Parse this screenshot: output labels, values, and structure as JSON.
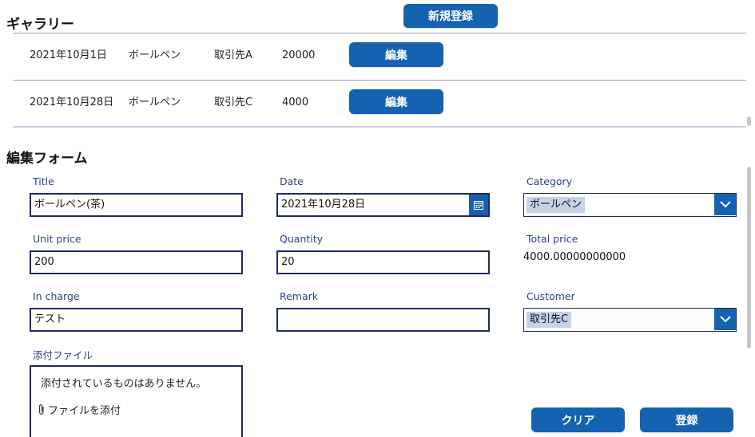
{
  "gallery": {
    "title": "ギャラリー",
    "new_button": "新規登録",
    "rows": [
      {
        "date": "2021年10月1日",
        "title": "ボールペン",
        "customer": "取引先A",
        "total": "20000",
        "edit_label": "編集"
      },
      {
        "date": "2021年10月28日",
        "title": "ボールペン",
        "customer": "取引先C",
        "total": "4000",
        "edit_label": "編集"
      }
    ]
  },
  "form": {
    "title": "編集フォーム",
    "fields": {
      "title": {
        "label": "Title",
        "value": "ボールペン(茶)"
      },
      "date": {
        "label": "Date",
        "value": "2021年10月28日"
      },
      "category": {
        "label": "Category",
        "value": "ボールペン"
      },
      "unit_price": {
        "label": "Unit price",
        "value": "200"
      },
      "quantity": {
        "label": "Quantity",
        "value": "20"
      },
      "total_price": {
        "label": "Total price",
        "value": "4000.00000000000"
      },
      "in_charge": {
        "label": "In charge",
        "value": "テスト"
      },
      "remark": {
        "label": "Remark",
        "value": ""
      },
      "customer": {
        "label": "Customer",
        "value": "取引先C"
      }
    },
    "attachments": {
      "label": "添付ファイル",
      "empty_text": "添付されているものはありません。",
      "add_label": "ファイルを添付"
    },
    "clear_button": "クリア",
    "submit_button": "登録"
  },
  "colors": {
    "accent": "#1462b0",
    "field_border": "#1e2a66",
    "label": "#2b3f86",
    "selection": "#c4d3e8"
  },
  "icons": {
    "date_picker": "calendar-icon",
    "dropdown": "chevron-down-icon",
    "attach": "paperclip-icon"
  }
}
